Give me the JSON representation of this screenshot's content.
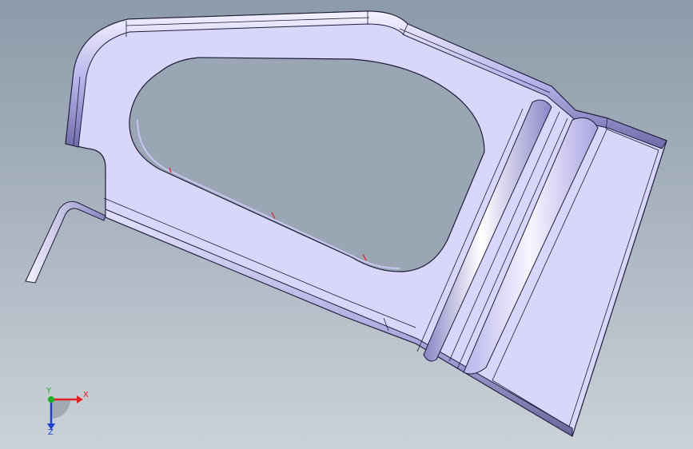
{
  "triad": {
    "x_label": "X",
    "y_label": "Y",
    "z_label": "Z",
    "x_color": "#e02020",
    "y_color": "#20b020",
    "z_color": "#2040d0"
  },
  "colors": {
    "part_face": "#d9d6fb",
    "part_face_dark": "#b4b0e6",
    "part_edge": "#1c1c38",
    "weld_mark": "#e02020"
  },
  "icons": [
    "coordinate-triad-icon"
  ]
}
